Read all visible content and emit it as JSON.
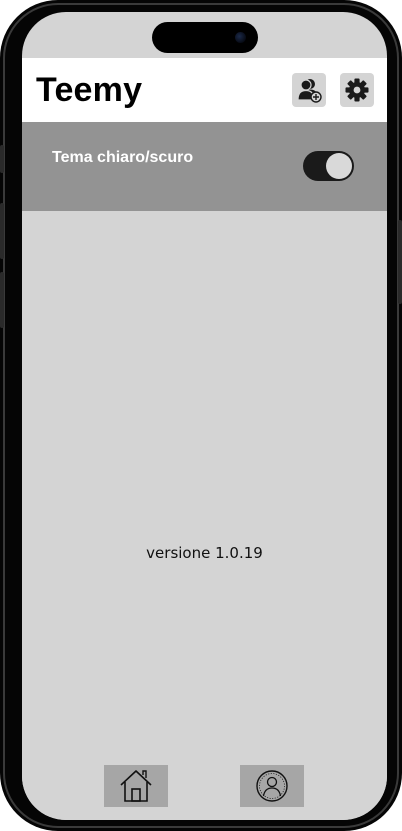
{
  "app": {
    "title": "Teemy"
  },
  "header": {
    "add_user_icon": "add-user-icon",
    "settings_icon": "gear-icon"
  },
  "settings": {
    "theme_label": "Tema chiaro/scuro",
    "theme_dark_enabled": true
  },
  "footer": {
    "version_text": "versione 1.0.19"
  },
  "tabbar": {
    "items": [
      {
        "icon": "home-icon",
        "selected": false
      },
      {
        "icon": "profile-icon",
        "selected": false
      }
    ]
  },
  "colors": {
    "screen_bg": "#d4d4d4",
    "header_bg": "#ffffff",
    "theme_row_bg": "#939393",
    "toggle_on": "#1a1a1a",
    "tab_bg": "#a6a6a6"
  }
}
